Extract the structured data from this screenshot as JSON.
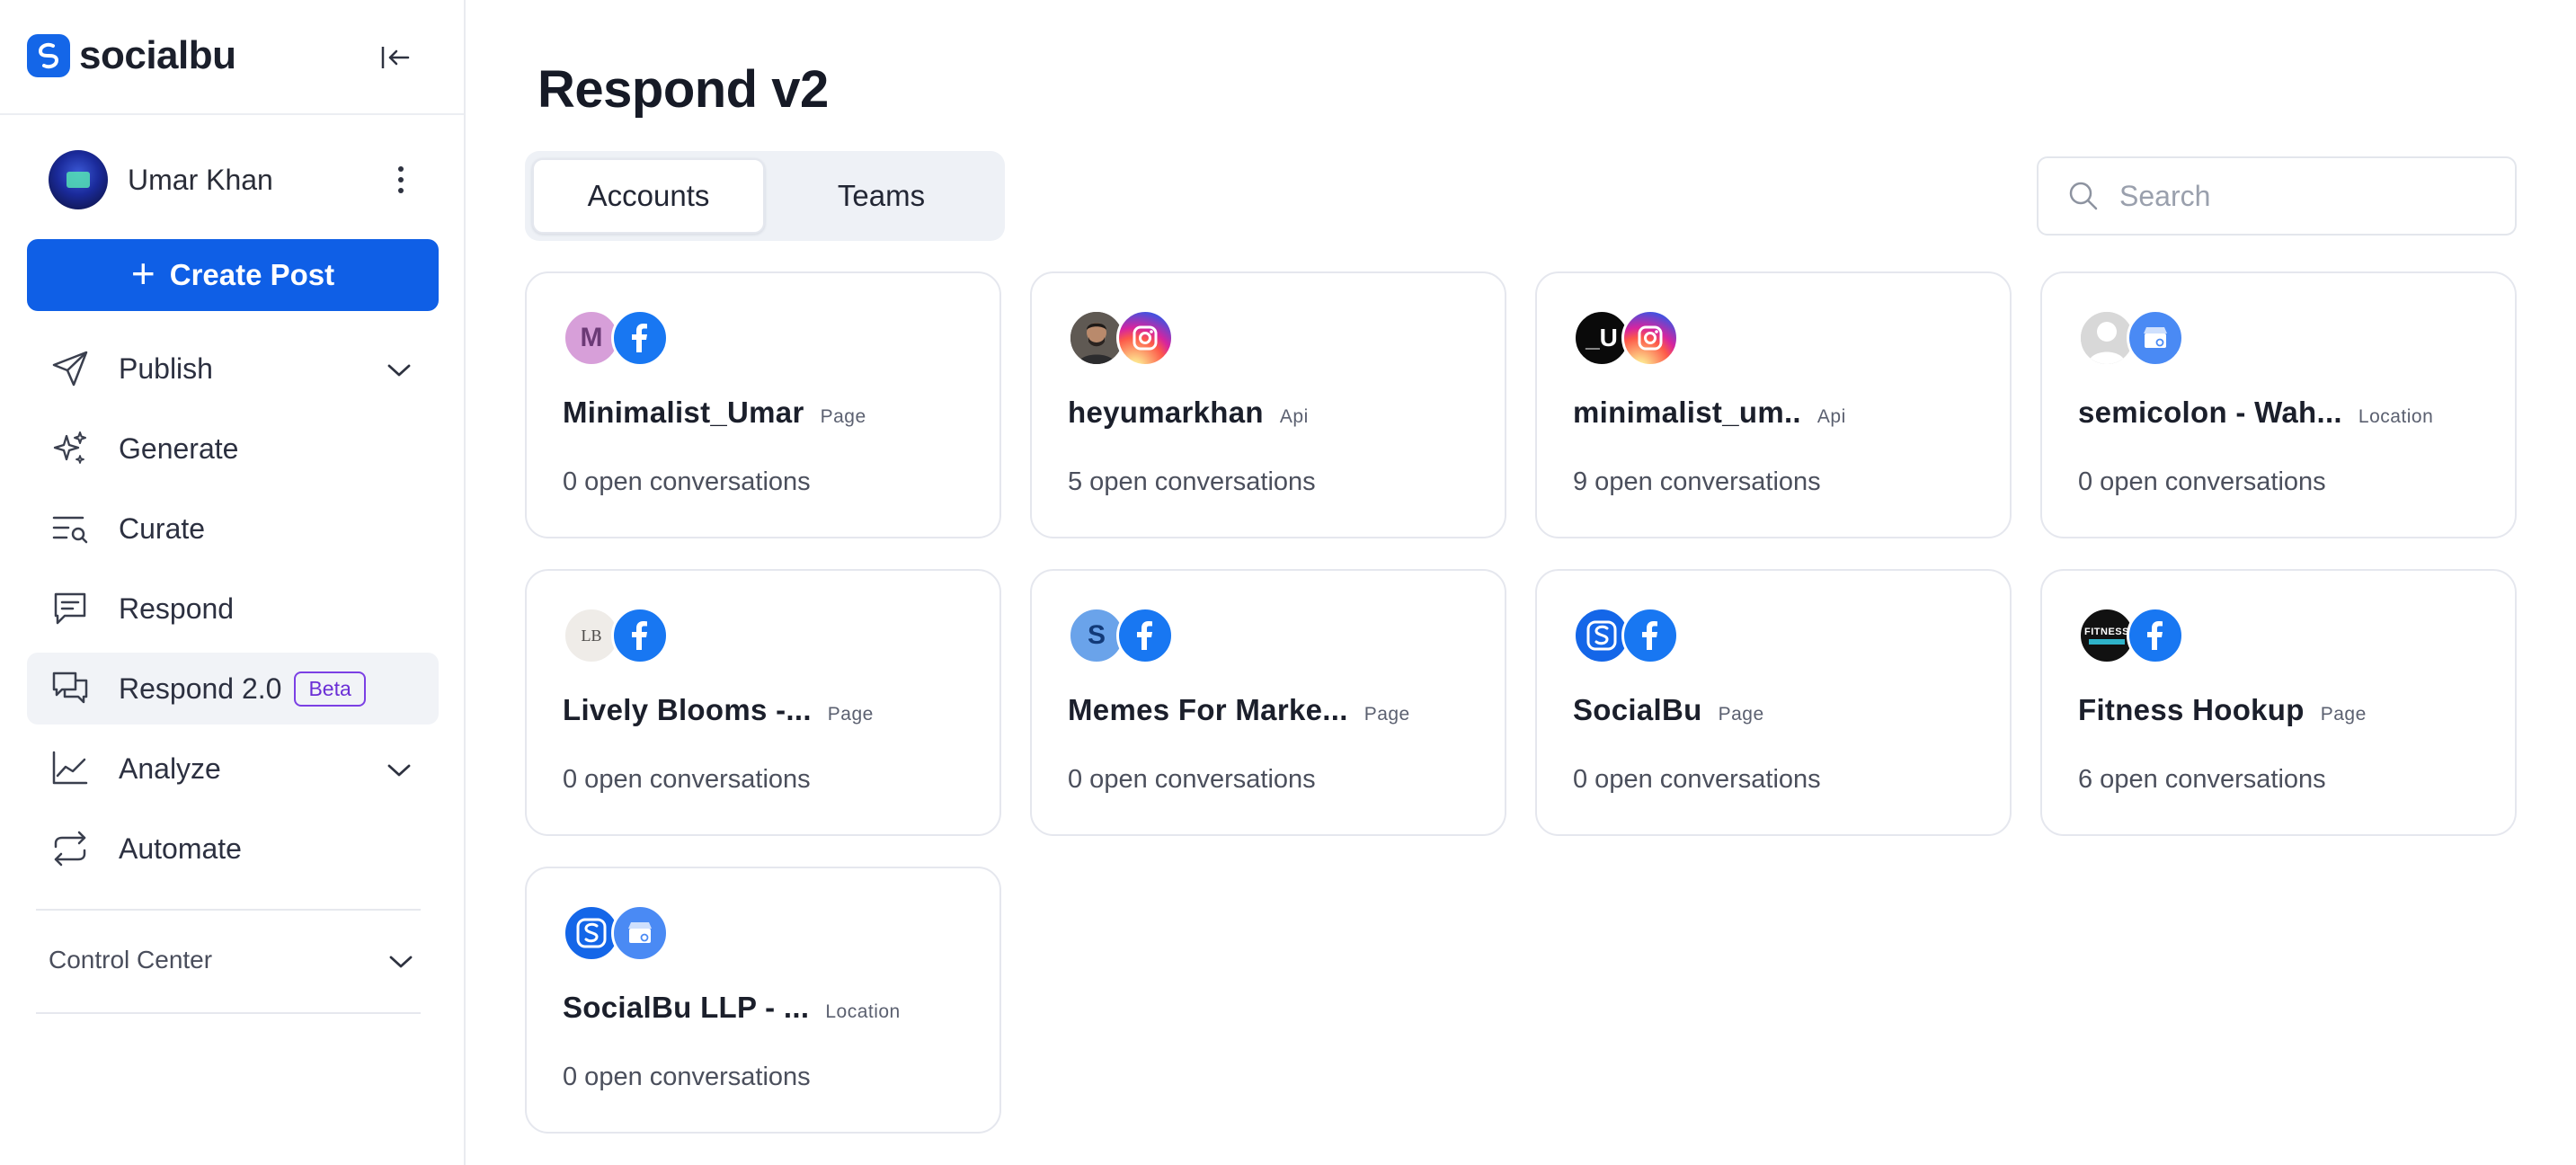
{
  "brand": {
    "name": "socialbu"
  },
  "user": {
    "name": "Umar Khan"
  },
  "sidebar": {
    "create_label": "Create Post",
    "items": [
      {
        "label": "Publish",
        "icon": "send-icon",
        "has_chevron": true
      },
      {
        "label": "Generate",
        "icon": "sparkles-icon",
        "has_chevron": false
      },
      {
        "label": "Curate",
        "icon": "curate-search-icon",
        "has_chevron": false
      },
      {
        "label": "Respond",
        "icon": "message-icon",
        "has_chevron": false
      },
      {
        "label": "Respond 2.0",
        "icon": "messages-icon",
        "has_chevron": false,
        "badge": "Beta",
        "active": true
      },
      {
        "label": "Analyze",
        "icon": "chart-line-icon",
        "has_chevron": true
      },
      {
        "label": "Automate",
        "icon": "repeat-icon",
        "has_chevron": false
      }
    ],
    "control_center": "Control Center"
  },
  "main": {
    "title": "Respond v2",
    "tabs": [
      {
        "label": "Accounts",
        "active": true
      },
      {
        "label": "Teams",
        "active": false
      }
    ],
    "search": {
      "placeholder": "Search",
      "value": ""
    },
    "accounts": [
      {
        "name": "Minimalist_Umar",
        "type": "Page",
        "conversations": "0 open conversations",
        "avatar": "M",
        "network": "facebook"
      },
      {
        "name": "heyumarkhan",
        "type": "Api",
        "conversations": "5 open conversations",
        "avatar": "",
        "network": "instagram"
      },
      {
        "name": "minimalist_um..",
        "type": "Api",
        "conversations": "9 open conversations",
        "avatar": "_U",
        "network": "instagram"
      },
      {
        "name": "semicolon - Wah...",
        "type": "Location",
        "conversations": "0 open conversations",
        "avatar": "",
        "network": "google-business"
      },
      {
        "name": "Lively Blooms -...",
        "type": "Page",
        "conversations": "0 open conversations",
        "avatar": "LB",
        "network": "facebook"
      },
      {
        "name": "Memes For Marke...",
        "type": "Page",
        "conversations": "0 open conversations",
        "avatar": "S",
        "network": "facebook"
      },
      {
        "name": "SocialBu",
        "type": "Page",
        "conversations": "0 open conversations",
        "avatar": "",
        "network": "facebook"
      },
      {
        "name": "Fitness Hookup",
        "type": "Page",
        "conversations": "6 open conversations",
        "avatar": "FITNESS",
        "network": "facebook"
      },
      {
        "name": "SocialBu LLP - ...",
        "type": "Location",
        "conversations": "0 open conversations",
        "avatar": "",
        "network": "google-business"
      }
    ]
  },
  "colors": {
    "accent": "#0f5fe6",
    "beta": "#6b2fd6",
    "facebook": "#1877f2",
    "google_business": "#4a8af4"
  }
}
